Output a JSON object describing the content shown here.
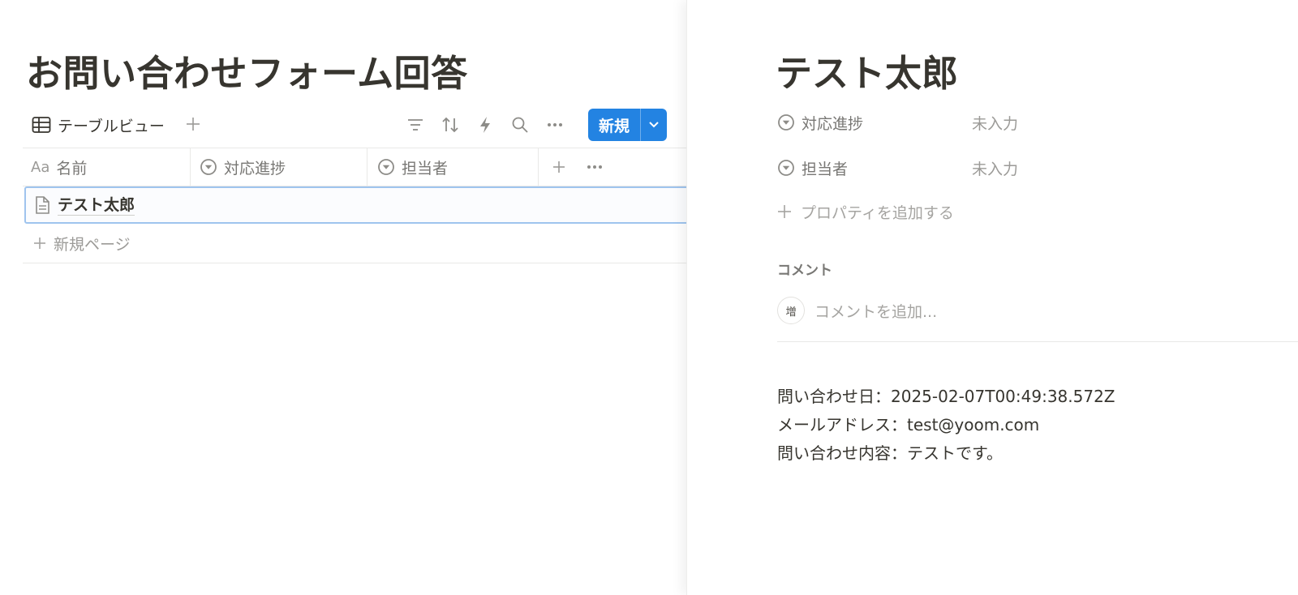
{
  "database": {
    "title": "お問い合わせフォーム回答",
    "view_tab_label": "テーブルビュー",
    "new_button_label": "新規",
    "columns": [
      {
        "label": "名前",
        "icon": "text-aa-icon"
      },
      {
        "label": "対応進捗",
        "icon": "select-icon"
      },
      {
        "label": "担当者",
        "icon": "select-icon"
      }
    ],
    "column_prefix": "Aa",
    "rows": [
      {
        "name": "テスト太郎",
        "progress": "",
        "assignee": ""
      }
    ],
    "new_page_label": "新規ページ",
    "accent_color": "#2383e2"
  },
  "peek": {
    "title": "テスト太郎",
    "properties": [
      {
        "name": "対応進捗",
        "value": "未入力"
      },
      {
        "name": "担当者",
        "value": "未入力"
      }
    ],
    "add_property_label": "プロパティを追加する",
    "comments_heading": "コメント",
    "avatar_initial": "増",
    "comment_placeholder": "コメントを追加...",
    "body_lines": [
      "問い合わせ日：2025-02-07T00:49:38.572Z",
      "メールアドレス：test@yoom.com",
      "問い合わせ内容：テストです。"
    ]
  }
}
